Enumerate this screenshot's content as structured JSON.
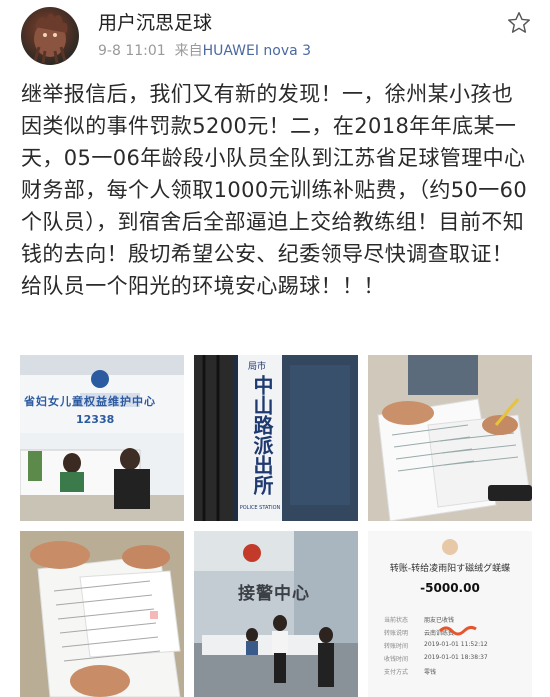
{
  "post": {
    "username": "用户沉思足球",
    "timestamp": "9-8 11:01",
    "via_prefix": "来自",
    "device": "HUAWEI nova 3",
    "text": "继举报信后，我们又有新的发现！一，徐州某小孩也因类似的事件罚款5200元！二，在2018年年底某一天，05一06年龄段小队员全队到江苏省足球管理中心财务部，每个人领取1000元训练补贴费，（约50一60个队员），到宿舍后全部逼迫上交给教练组！目前不知钱的去向！殷切希望公安、纪委领导尽快调查取证！给队员一个阳光的环境安心踢球！！！"
  },
  "icons": {
    "favorite": "star-outline-icon",
    "avatar": "user-avatar"
  },
  "photos": {
    "photo1_sign": "省妇女儿童权益维护中心",
    "photo1_hotline": "12338",
    "photo2_sign_top": "局市",
    "photo2_sign": "中山路派出所",
    "photo2_sign_en": "POLICE STATION",
    "photo5_sign": "接警中心",
    "payment": {
      "title": "转账-转给凌雨阳す磁绒グ蜣蝶",
      "amount": "-5000.00",
      "rows": [
        {
          "label": "当前状态",
          "value": "朋友已收钱"
        },
        {
          "label": "转账说明",
          "value": "云南训练费"
        },
        {
          "label": "转账时间",
          "value": "2019-01-01 11:52:12"
        },
        {
          "label": "收钱时间",
          "value": "2019-01-01 18:38:37"
        },
        {
          "label": "支付方式",
          "value": "零钱"
        }
      ]
    }
  },
  "colors": {
    "device_link": "#4b6aa0",
    "meta_gray": "#9a9a9a"
  }
}
